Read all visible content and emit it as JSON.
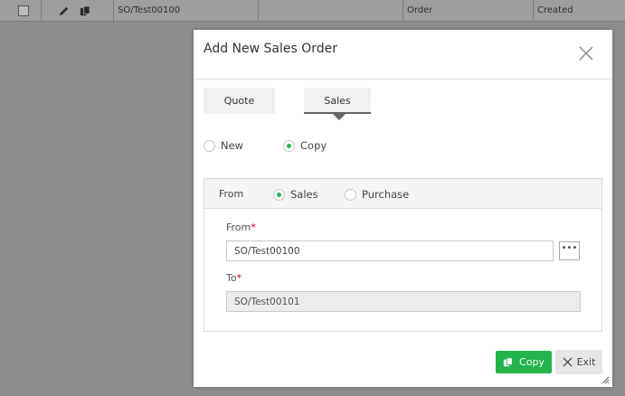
{
  "background_row": {
    "order_number": "SO/Test00100",
    "type": "Order",
    "status": "Created"
  },
  "modal": {
    "title": "Add New Sales Order",
    "tabs": [
      {
        "label": "Quote",
        "selected": false
      },
      {
        "label": "Sales",
        "selected": true
      }
    ],
    "mode_options": [
      {
        "label": "New",
        "selected": false
      },
      {
        "label": "Copy",
        "selected": true
      }
    ],
    "source": {
      "label": "From",
      "options": [
        {
          "label": "Sales",
          "selected": true
        },
        {
          "label": "Purchase",
          "selected": false
        }
      ]
    },
    "from_field": {
      "label": "From",
      "required_mark": "*",
      "value": "SO/Test00100",
      "more_label": "•••"
    },
    "to_field": {
      "label": "To",
      "required_mark": "*",
      "value": "SO/Test00101"
    },
    "buttons": {
      "copy_label": "Copy",
      "exit_label": "Exit"
    }
  },
  "colors": {
    "accent_green": "#22b34a",
    "required_red": "#d0021b"
  }
}
